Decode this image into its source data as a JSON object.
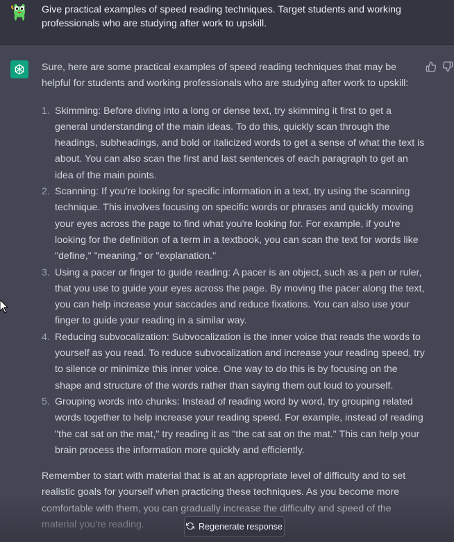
{
  "user_message": {
    "avatar_icon": "user-avatar-icon",
    "text": "Give practical examples of speed reading techniques. Target students and working professionals who are studying after work to upskill."
  },
  "assistant_message": {
    "avatar_icon": "openai-logo-icon",
    "intro": "Sure, here are some practical examples of speed reading techniques that may be helpful for students and working professionals who are studying after work to upskill:",
    "items": [
      {
        "num": "1.",
        "text": "Skimming: Before diving into a long or dense text, try skimming it first to get a general understanding of the main ideas. To do this, quickly scan through the headings, subheadings, and bold or italicized words to get a sense of what the text is about. You can also scan the first and last sentences of each paragraph to get an idea of the main points."
      },
      {
        "num": "2.",
        "text": "Scanning: If you're looking for specific information in a text, try using the scanning technique. This involves focusing on specific words or phrases and quickly moving your eyes across the page to find what you're looking for. For example, if you're looking for the definition of a term in a textbook, you can scan the text for words like \"define,\" \"meaning,\" or \"explanation.\""
      },
      {
        "num": "3.",
        "text": "Using a pacer or finger to guide reading: A pacer is an object, such as a pen or ruler, that you use to guide your eyes across the page. By moving the pacer along the text, you can help increase your saccades and reduce fixations. You can also use your finger to guide your reading in a similar way."
      },
      {
        "num": "4.",
        "text": "Reducing subvocalization: Subvocalization is the inner voice that reads the words to yourself as you read. To reduce subvocalization and increase your reading speed, try to silence or minimize this inner voice. One way to do this is by focusing on the shape and structure of the words rather than saying them out loud to yourself."
      },
      {
        "num": "5.",
        "text": "Grouping words into chunks: Instead of reading word by word, try grouping related words together to help increase your reading speed. For example, instead of reading \"the cat sat on the mat,\" try reading it as \"the cat sat on the mat.\" This can help your brain process the information more quickly and efficiently."
      }
    ],
    "outro": "Remember to start with material that is at an appropriate level of difficulty and to set realistic goals for yourself when practicing these techniques. As you become more comfortable with them, you can gradually increase the difficulty and speed of the material you're reading."
  },
  "controls": {
    "thumbs_up_icon": "thumbs-up-icon",
    "thumbs_down_icon": "thumbs-down-icon",
    "regenerate_label": "Regenerate response",
    "regenerate_icon": "refresh-icon"
  },
  "colors": {
    "user_bg": "#343541",
    "assistant_bg": "#444654",
    "accent": "#10a37f",
    "text": "#d1d5db"
  }
}
